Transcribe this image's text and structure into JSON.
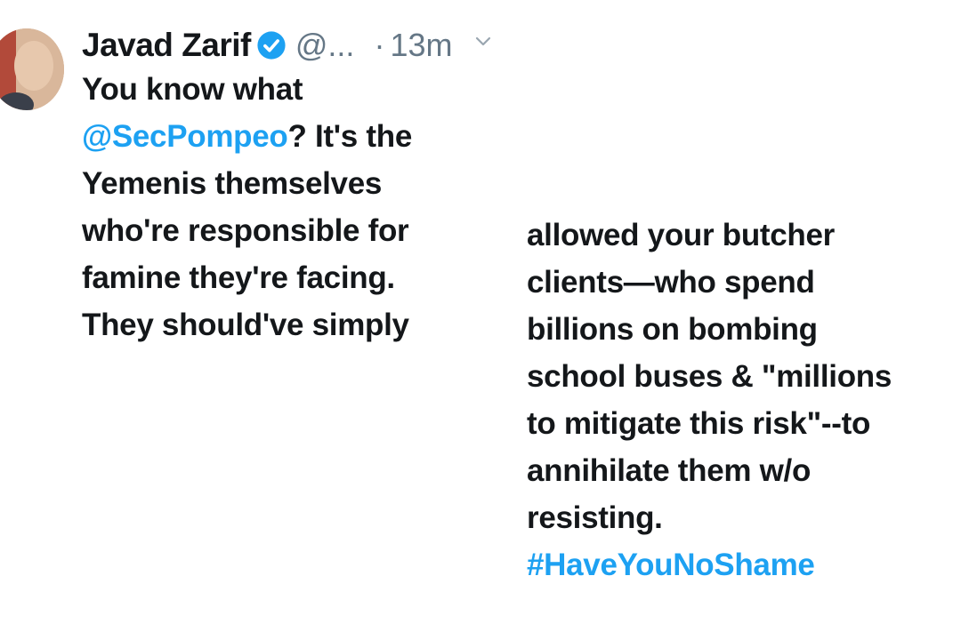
{
  "tweet": {
    "author_name": "Javad Zarif",
    "handle": "@...",
    "separator": "·",
    "timestamp": "13m",
    "left_column": {
      "line1": "You know what",
      "mention": "@SecPompeo",
      "line2_rest": "? It's the",
      "line3": "Yemenis themselves",
      "line4": "who're responsible for",
      "line5": "famine they're facing.",
      "line6": "They should've simply"
    },
    "right_column": {
      "line1": "allowed your butcher",
      "line2": "clients—who spend",
      "line3": "billions on bombing",
      "line4": "school buses & \"millions",
      "line5": "to mitigate this risk\"--to",
      "line6": "annihilate them w/o",
      "line7": "resisting.",
      "hashtag": "#HaveYouNoShame"
    }
  },
  "colors": {
    "text": "#14171a",
    "link": "#1da1f2",
    "secondary": "#657786",
    "verified": "#1da1f2"
  },
  "icons": {
    "verified": "verified-badge-icon",
    "caret": "chevron-down-icon"
  }
}
